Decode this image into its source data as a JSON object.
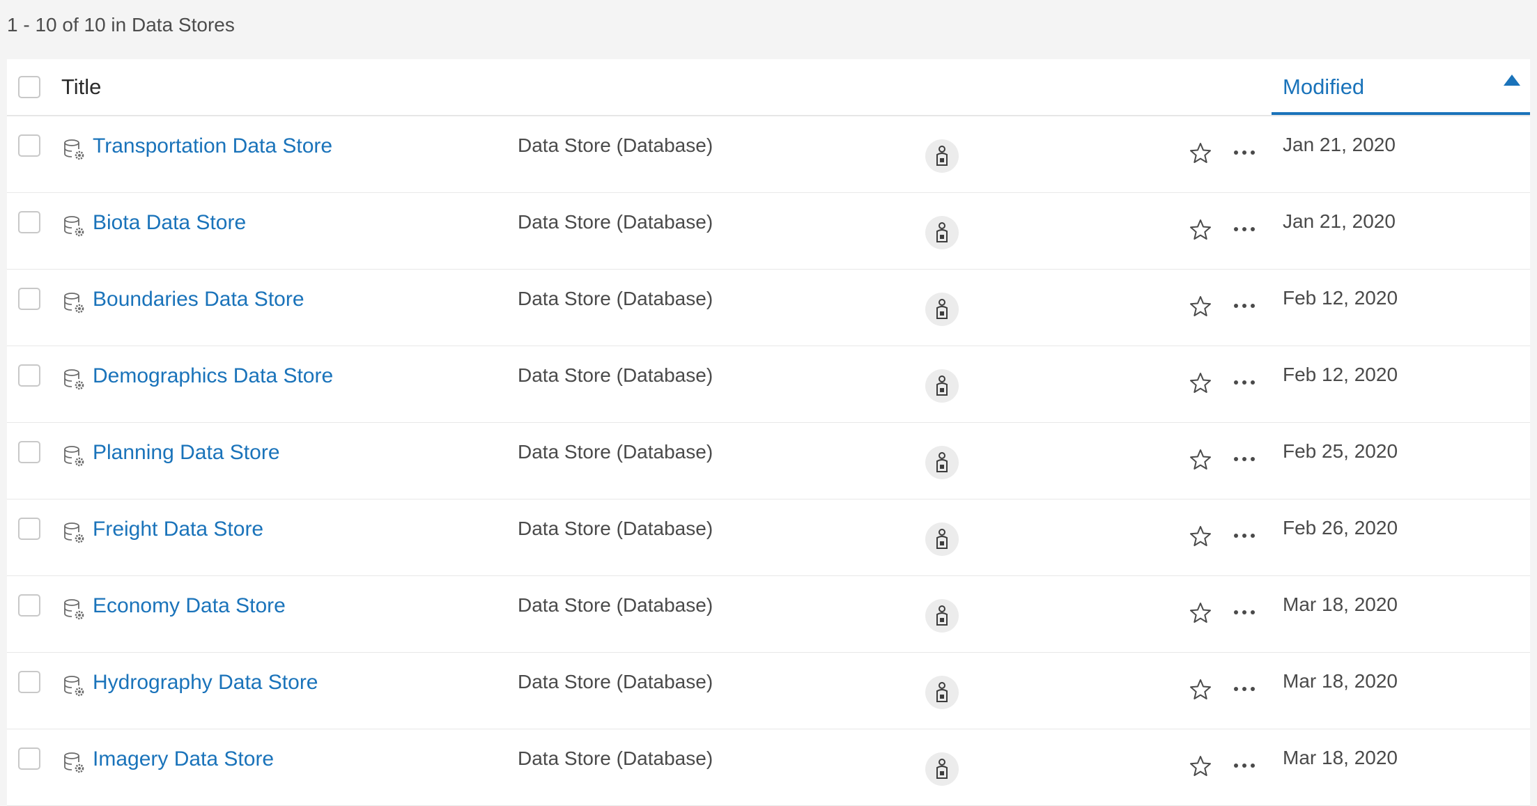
{
  "summary": "1 - 10 of 10 in Data Stores",
  "header": {
    "title_label": "Title",
    "modified_label": "Modified"
  },
  "colors": {
    "link": "#1a73ba",
    "background": "#f4f4f4"
  },
  "icons": {
    "item_icon": "database-gear-icon",
    "owner_icon": "user-lock-icon",
    "favorite_icon": "star-outline-icon",
    "more_icon": "ellipsis-icon",
    "sort_icon": "sort-ascending-triangle-icon"
  },
  "rows": [
    {
      "title": "Transportation Data Store",
      "type": "Data Store (Database)",
      "modified": "Jan 21, 2020"
    },
    {
      "title": "Biota Data Store",
      "type": "Data Store (Database)",
      "modified": "Jan 21, 2020"
    },
    {
      "title": "Boundaries Data Store",
      "type": "Data Store (Database)",
      "modified": "Feb 12, 2020"
    },
    {
      "title": "Demographics Data Store",
      "type": "Data Store (Database)",
      "modified": "Feb 12, 2020"
    },
    {
      "title": "Planning Data Store",
      "type": "Data Store (Database)",
      "modified": "Feb 25, 2020"
    },
    {
      "title": "Freight Data Store",
      "type": "Data Store (Database)",
      "modified": "Feb 26, 2020"
    },
    {
      "title": "Economy Data Store",
      "type": "Data Store (Database)",
      "modified": "Mar 18, 2020"
    },
    {
      "title": "Hydrography Data Store",
      "type": "Data Store (Database)",
      "modified": "Mar 18, 2020"
    },
    {
      "title": "Imagery Data Store",
      "type": "Data Store (Database)",
      "modified": "Mar 18, 2020"
    }
  ]
}
